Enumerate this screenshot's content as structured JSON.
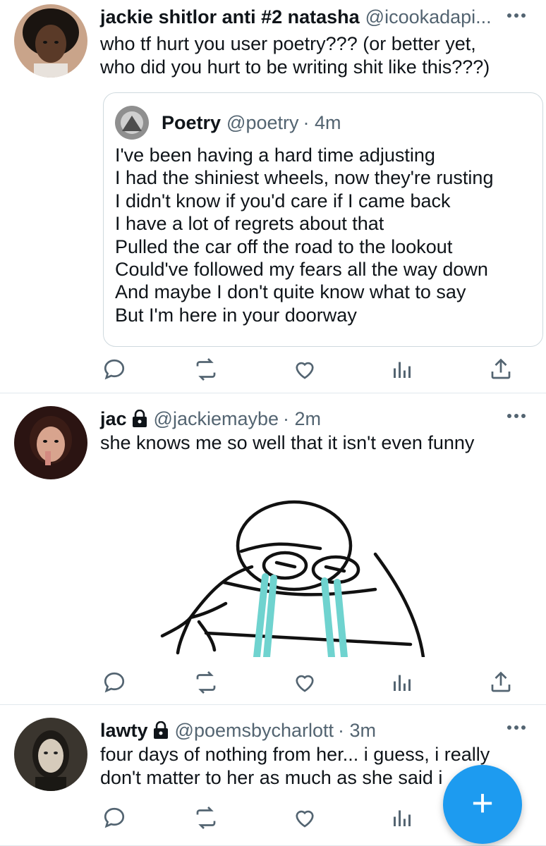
{
  "tweets": [
    {
      "name": "jackie shitlor anti #2 natasha",
      "handle": "@icookadapi...",
      "text": "who tf hurt you user poetry??? (or better yet,\nwho did you hurt to be writing shit like this???)",
      "quote": {
        "name": "Poetry",
        "handle": "@poetry",
        "time": "· 4m",
        "text": "I've been having a hard time adjusting\nI had the shiniest wheels, now they're rusting\nI didn't know if you'd care if I came back\nI have a lot of regrets about that\nPulled the car off the road to the lookout\nCould've followed my fears all the way down\nAnd maybe I don't quite know what to say\nBut I'm here in your doorway"
      }
    },
    {
      "name": "jac",
      "handle": "@jackiemaybe",
      "time": "· 2m",
      "text": "she knows me so well that it isn't even funny",
      "protected": true
    },
    {
      "name": "lawty",
      "handle": "@poemsbycharlott",
      "time": "· 3m",
      "text": "four days of nothing from her... i guess, i really\ndon't matter to her as much as she said i",
      "protected": true
    }
  ],
  "actions": [
    "reply-icon",
    "retweet-icon",
    "like-icon",
    "analytics-icon",
    "share-icon"
  ],
  "fab": {
    "label": "+",
    "color": "#1d9bf0"
  },
  "colors": {
    "text": "#0f1419",
    "secondary": "#536471",
    "accent": "#1d9bf0",
    "teal": "#6fd3cf"
  }
}
